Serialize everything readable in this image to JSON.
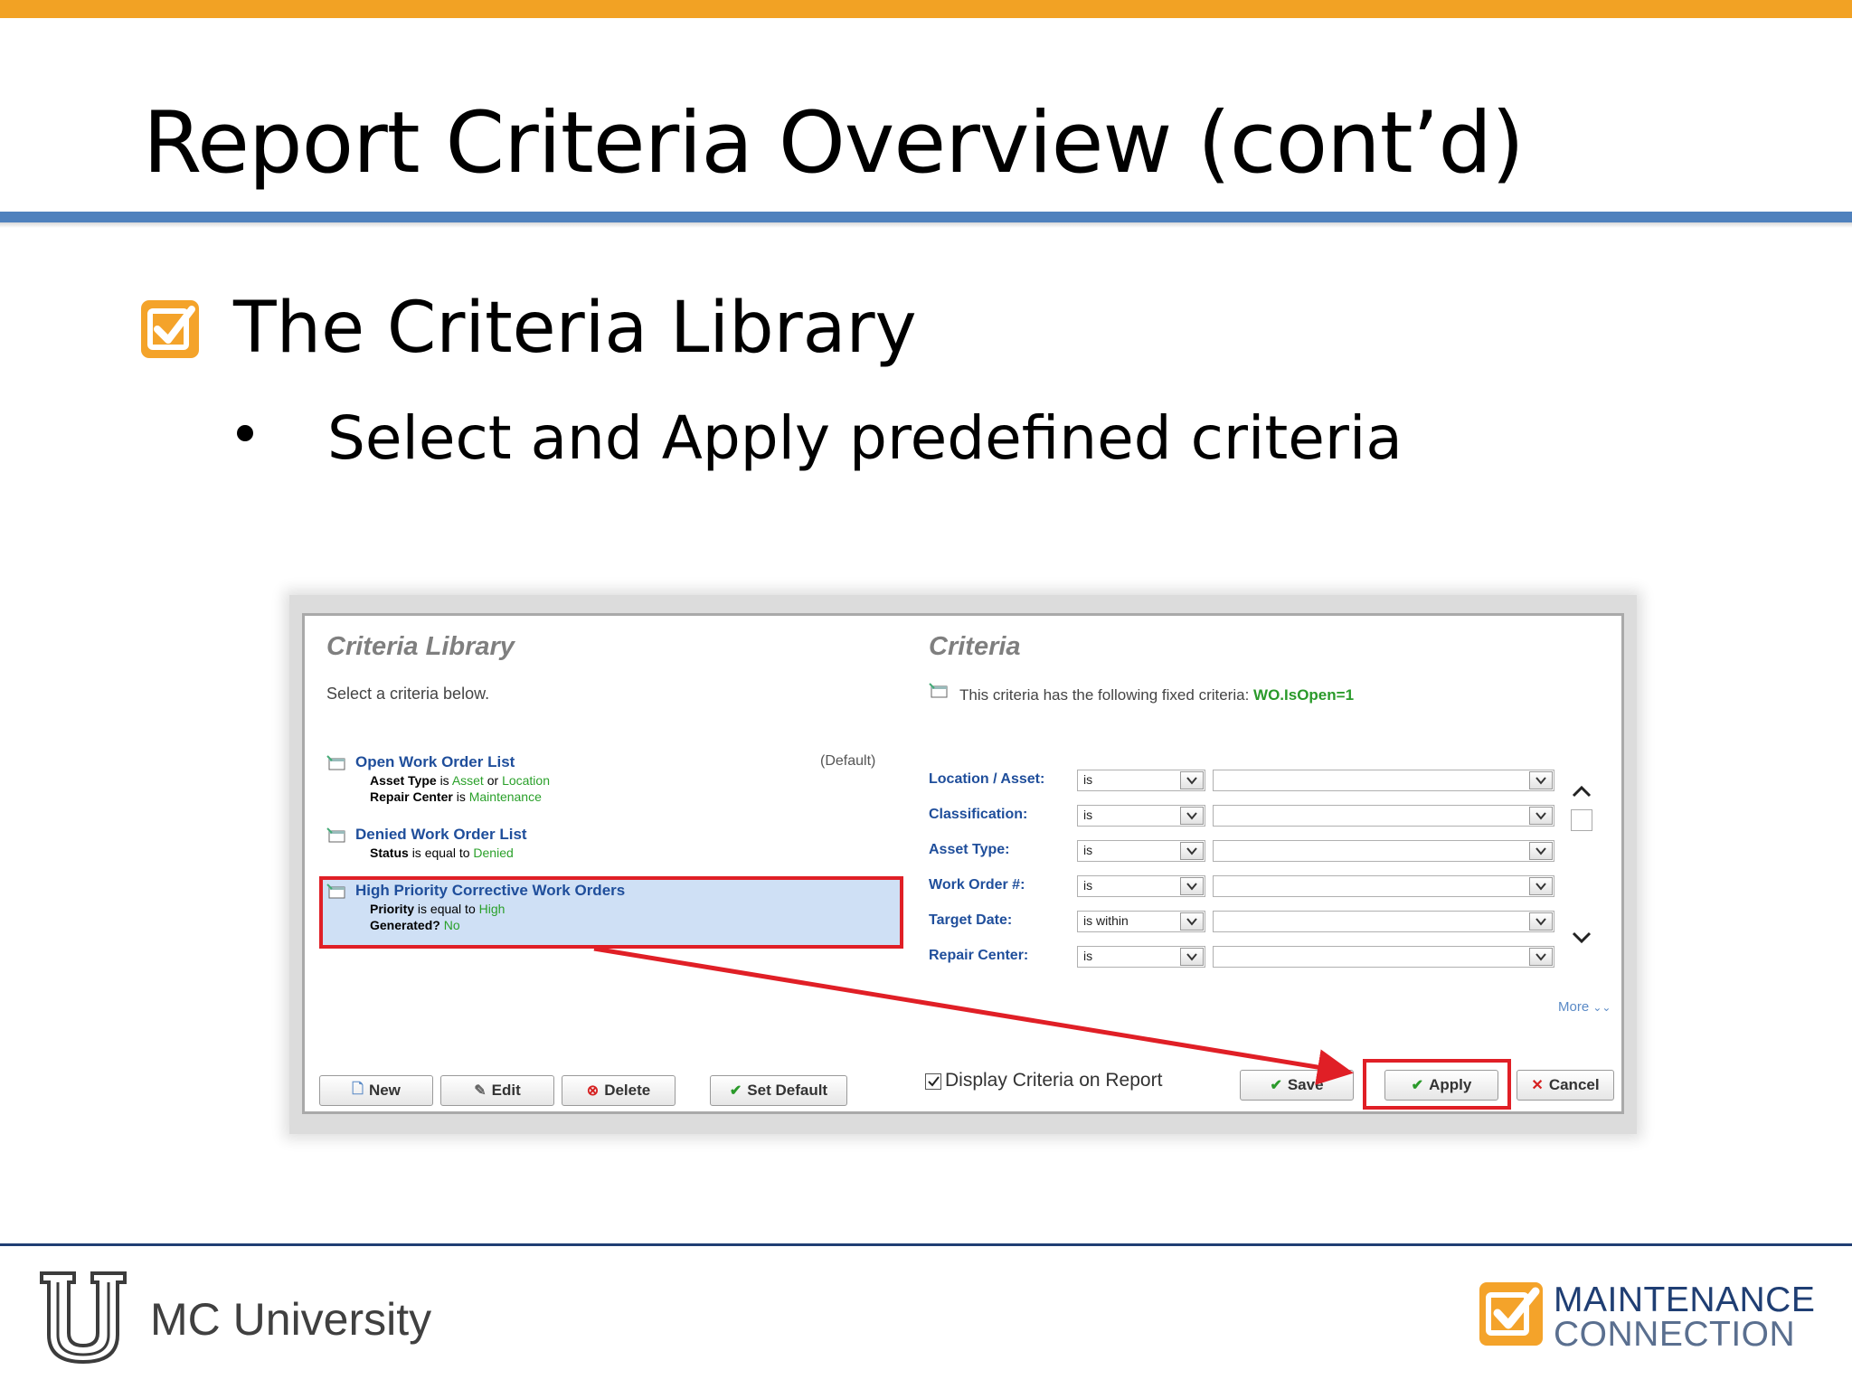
{
  "colors": {
    "accent_orange": "#f2a224",
    "title_rule_blue": "#4f81bd",
    "link_blue": "#1f4e9b",
    "green_text": "#2aa02a",
    "highlight_red": "#e01f26"
  },
  "slide": {
    "title": "Report Criteria Overview (cont’d)",
    "heading": "The Criteria Library",
    "bullet": "Select and Apply predefined criteria"
  },
  "criteria_library": {
    "title": "Criteria Library",
    "instruction": "Select a criteria below.",
    "default_tag": "(Default)",
    "items": [
      {
        "name": "Open Work Order List",
        "line1": {
          "field": "Asset Type",
          "op": "is",
          "value": "Asset",
          "conj": "or",
          "value2": "Location"
        },
        "line2": {
          "field": "Repair Center",
          "op": "is",
          "value": "Maintenance"
        }
      },
      {
        "name": "Denied Work Order List",
        "line1": {
          "field": "Status",
          "op": "is equal to",
          "value": "Denied"
        }
      },
      {
        "name": "High Priority Corrective Work Orders",
        "line1": {
          "field": "Priority",
          "op": "is equal to",
          "value": "High"
        },
        "line2": {
          "field": "Generated?",
          "value": "No"
        }
      }
    ],
    "buttons": {
      "new": "New",
      "edit": "Edit",
      "delete": "Delete",
      "set_default": "Set Default"
    }
  },
  "criteria": {
    "title": "Criteria",
    "fixed_note": "This criteria has the following fixed criteria:",
    "fixed_value": "WO.IsOpen=1",
    "rows": [
      {
        "label": "Location / Asset:",
        "operator": "is"
      },
      {
        "label": "Classification:",
        "operator": "is"
      },
      {
        "label": "Asset Type:",
        "operator": "is"
      },
      {
        "label": "Work Order #:",
        "operator": "is"
      },
      {
        "label": "Target Date:",
        "operator": "is within"
      },
      {
        "label": "Repair Center:",
        "operator": "is"
      }
    ],
    "more_link": "More",
    "display_checkbox_label": "Display Criteria on Report",
    "display_checked": true,
    "buttons": {
      "save": "Save",
      "apply": "Apply",
      "cancel": "Cancel"
    }
  },
  "footer": {
    "university": "MC University",
    "brand_line1": "MAINTENANCE",
    "brand_line2": "CONNECTION"
  }
}
